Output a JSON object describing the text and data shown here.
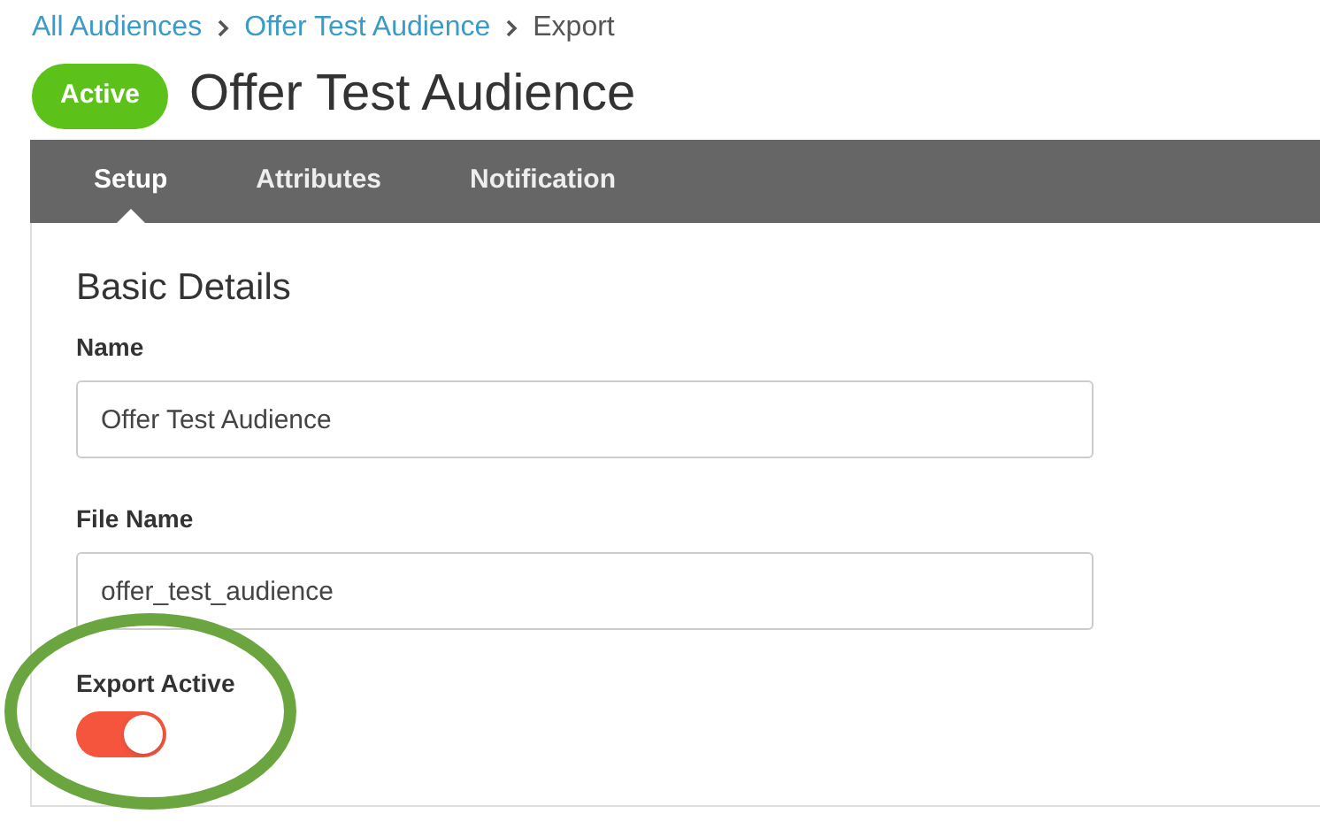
{
  "breadcrumb": [
    {
      "label": "All Audiences",
      "kind": "link"
    },
    {
      "label": "Offer Test Audience",
      "kind": "link"
    },
    {
      "label": "Export",
      "kind": "current"
    }
  ],
  "header": {
    "status": "Active",
    "title": "Offer Test Audience"
  },
  "tabs": [
    {
      "label": "Setup",
      "selected": true
    },
    {
      "label": "Attributes",
      "selected": false
    },
    {
      "label": "Notification",
      "selected": false
    }
  ],
  "section": {
    "title": "Basic Details",
    "fields": [
      {
        "label": "Name",
        "value": "Offer Test Audience"
      },
      {
        "label": "File Name",
        "value": "offer_test_audience"
      }
    ],
    "toggle": {
      "label": "Export Active",
      "on": true,
      "highlighted": true
    }
  }
}
